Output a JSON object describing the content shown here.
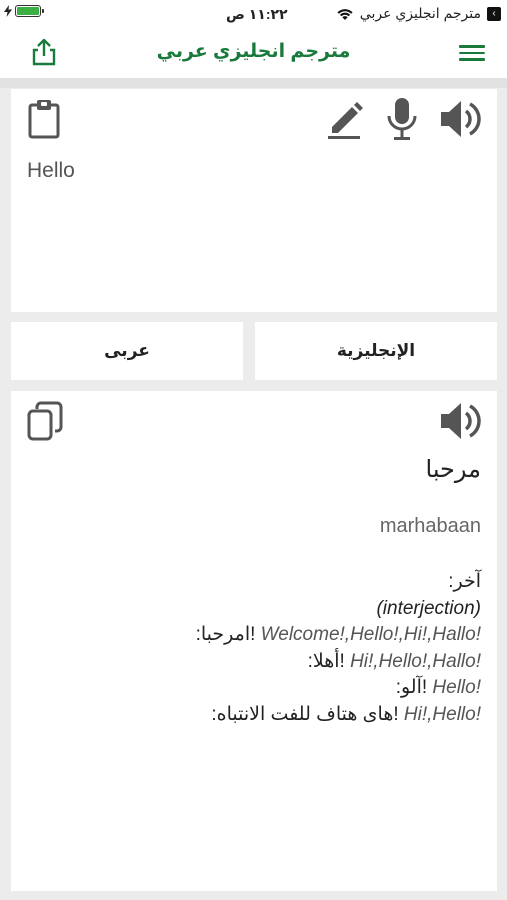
{
  "status_bar": {
    "app_back_label": "مترجم انجليزي عربي",
    "time": "١١:٢٢ ص"
  },
  "header": {
    "title": "مترجم انجليزي عربي",
    "icons": {
      "left": "share-icon",
      "right": "menu-icon"
    }
  },
  "input": {
    "text": "Hello",
    "icons": [
      "clipboard-icon",
      "pencil-icon",
      "microphone-icon",
      "speaker-icon"
    ]
  },
  "languages": {
    "source": "الإنجليزية",
    "target": "عربى"
  },
  "output": {
    "translation": "مرحبا",
    "transliteration": "marhabaan",
    "icons": [
      "copy-icon",
      "speaker-icon"
    ],
    "dictionary": {
      "other_label": ":آخر",
      "part_of_speech": "(interjection)",
      "entries": [
        {
          "arabic": ":امرحبا!",
          "english": "Welcome!,Hello!,Hi!,Hallo!"
        },
        {
          "arabic": ":أهلا!",
          "english": "Hi!,Hello!,Hallo!"
        },
        {
          "arabic": ":آلو!",
          "english": "Hello!"
        },
        {
          "arabic": ":هاى هتاف للفت الانتباه!",
          "english": "Hi!,Hello!"
        }
      ]
    }
  },
  "colors": {
    "accent": "#1a7a3c",
    "background": "#ececec",
    "card": "#ffffff",
    "battery": "#3cb043"
  }
}
